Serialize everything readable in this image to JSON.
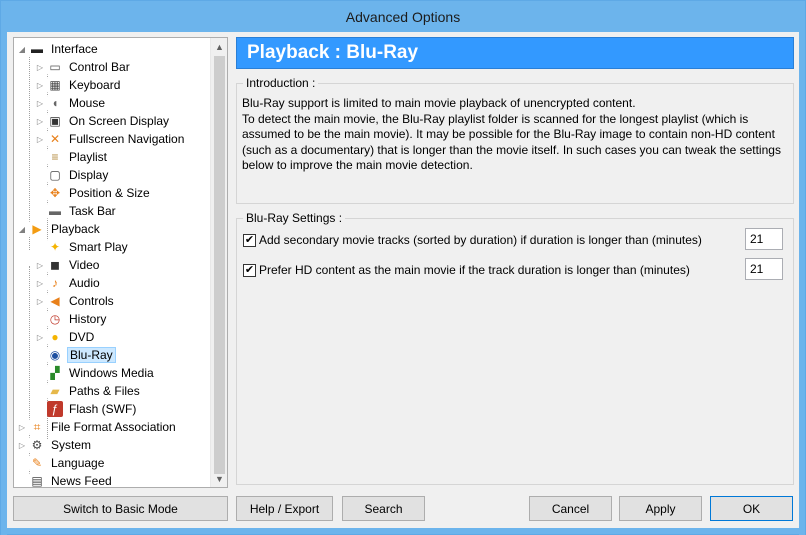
{
  "window": {
    "title": "Advanced Options"
  },
  "tree": [
    {
      "label": "Interface",
      "level": 0,
      "expander": "◢",
      "icon": "monitor-icon"
    },
    {
      "label": "Control Bar",
      "level": 1,
      "expander": "▷",
      "icon": "control-bar-icon"
    },
    {
      "label": "Keyboard",
      "level": 1,
      "expander": "▷",
      "icon": "keyboard-icon"
    },
    {
      "label": "Mouse",
      "level": 1,
      "expander": "▷",
      "icon": "mouse-icon"
    },
    {
      "label": "On Screen Display",
      "level": 1,
      "expander": "▷",
      "icon": "osd-icon"
    },
    {
      "label": "Fullscreen Navigation",
      "level": 1,
      "expander": "▷",
      "icon": "fullscreen-icon"
    },
    {
      "label": "Playlist",
      "level": 1,
      "expander": "",
      "icon": "playlist-icon"
    },
    {
      "label": "Display",
      "level": 1,
      "expander": "",
      "icon": "display-icon"
    },
    {
      "label": "Position & Size",
      "level": 1,
      "expander": "",
      "icon": "position-icon"
    },
    {
      "label": "Task Bar",
      "level": 1,
      "expander": "",
      "icon": "taskbar-icon"
    },
    {
      "label": "Playback",
      "level": 0,
      "expander": "◢",
      "icon": "play-icon"
    },
    {
      "label": "Smart Play",
      "level": 1,
      "expander": "",
      "icon": "smart-play-icon"
    },
    {
      "label": "Video",
      "level": 1,
      "expander": "▷",
      "icon": "video-icon"
    },
    {
      "label": "Audio",
      "level": 1,
      "expander": "▷",
      "icon": "audio-icon"
    },
    {
      "label": "Controls",
      "level": 1,
      "expander": "▷",
      "icon": "controls-icon"
    },
    {
      "label": "History",
      "level": 1,
      "expander": "",
      "icon": "history-icon"
    },
    {
      "label": "DVD",
      "level": 1,
      "expander": "▷",
      "icon": "dvd-icon"
    },
    {
      "label": "Blu-Ray",
      "level": 1,
      "expander": "",
      "icon": "bluray-icon",
      "selected": true
    },
    {
      "label": "Windows Media",
      "level": 1,
      "expander": "",
      "icon": "windows-media-icon"
    },
    {
      "label": "Paths & Files",
      "level": 1,
      "expander": "",
      "icon": "folder-icon"
    },
    {
      "label": "Flash (SWF)",
      "level": 1,
      "expander": "",
      "icon": "flash-icon"
    },
    {
      "label": "File Format Association",
      "level": 0,
      "expander": "▷",
      "icon": "file-association-icon"
    },
    {
      "label": "System",
      "level": 0,
      "expander": "▷",
      "icon": "gear-icon"
    },
    {
      "label": "Language",
      "level": 0,
      "expander": "",
      "icon": "language-icon"
    },
    {
      "label": "News Feed",
      "level": 0,
      "expander": "",
      "icon": "news-icon"
    }
  ],
  "header": {
    "title": "Playback : Blu-Ray"
  },
  "intro": {
    "caption": "Introduction :",
    "line1": "Blu-Ray support is limited to main movie playback of unencrypted content.",
    "line2": "To detect the main movie, the Blu-Ray playlist folder is scanned for the longest playlist (which is assumed to be the main movie).  It may be possible for the Blu-Ray image to contain non-HD content (such as a documentary) that is longer than the movie itself.  In such cases you can tweak the settings below to improve the main movie detection."
  },
  "settings": {
    "caption": "Blu-Ray Settings :",
    "options": [
      {
        "label": "Add secondary movie tracks (sorted by duration) if duration is longer than (minutes)",
        "checked": true,
        "value": "21"
      },
      {
        "label": "Prefer HD content as the main movie if the track duration is longer than (minutes)",
        "checked": true,
        "value": "21"
      }
    ]
  },
  "buttons": {
    "basic_mode": "Switch to Basic Mode",
    "help": "Help / Export",
    "search": "Search",
    "cancel": "Cancel",
    "apply": "Apply",
    "ok": "OK"
  },
  "colors": {
    "header_bg": "#3399ff",
    "title_bar": "#6cb4ec",
    "selection": "#cce8ff"
  }
}
